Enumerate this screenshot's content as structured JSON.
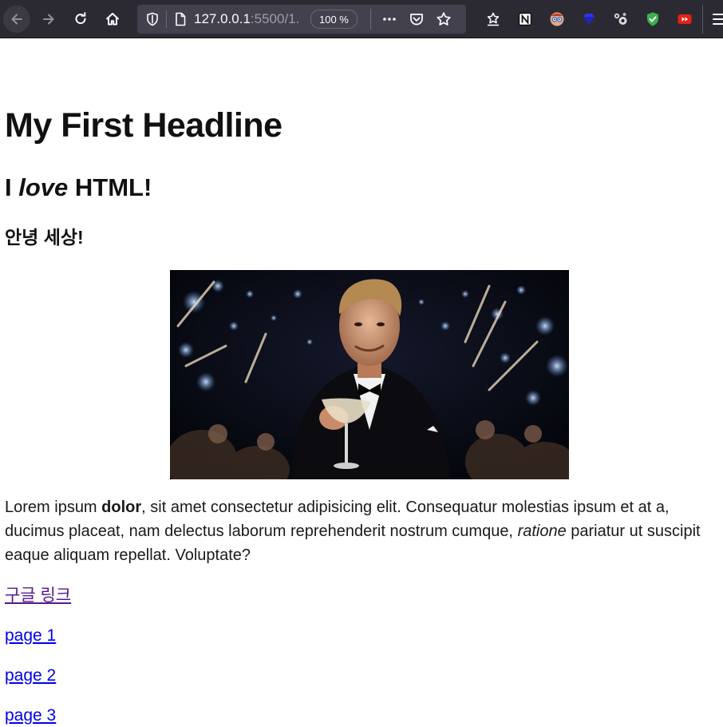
{
  "browser": {
    "url_host": "127.0.0.1",
    "url_rest": ":5500/1.",
    "zoom": "100 %",
    "extensions": [
      "reading-list-icon",
      "notion-icon",
      "glasses-icon",
      "gem-icon",
      "molecule-icon",
      "shield-check-icon",
      "youtube-ff-icon"
    ]
  },
  "page": {
    "h1_part1": "My ",
    "h1_part2": "First Headline",
    "h2_part1": "I ",
    "h2_em": "love",
    "h2_part2": " HTML!",
    "h3": "안녕 세상!",
    "paragraph": {
      "t1": "Lorem ipsum ",
      "bold": "dolor",
      "t2": ", sit amet consectetur adipisicing elit. Consequatur molestias ipsum et at a, ducimus placeat, nam delectus laborum reprehenderit nostrum cumque, ",
      "em": "ratione",
      "t3": " pariatur ut suscipit eaque aliquam repellat. Voluptate?"
    },
    "links": [
      {
        "label": "구글 링크",
        "visited": true
      },
      {
        "label": "page 1",
        "visited": false
      },
      {
        "label": "page 2",
        "visited": false
      },
      {
        "label": "page 3",
        "visited": false
      }
    ]
  },
  "colors": {
    "toolbar_bg": "#2b2a33",
    "urlbar_bg": "#42414d",
    "link": "#0000ee",
    "visited_link": "#551a8b"
  }
}
